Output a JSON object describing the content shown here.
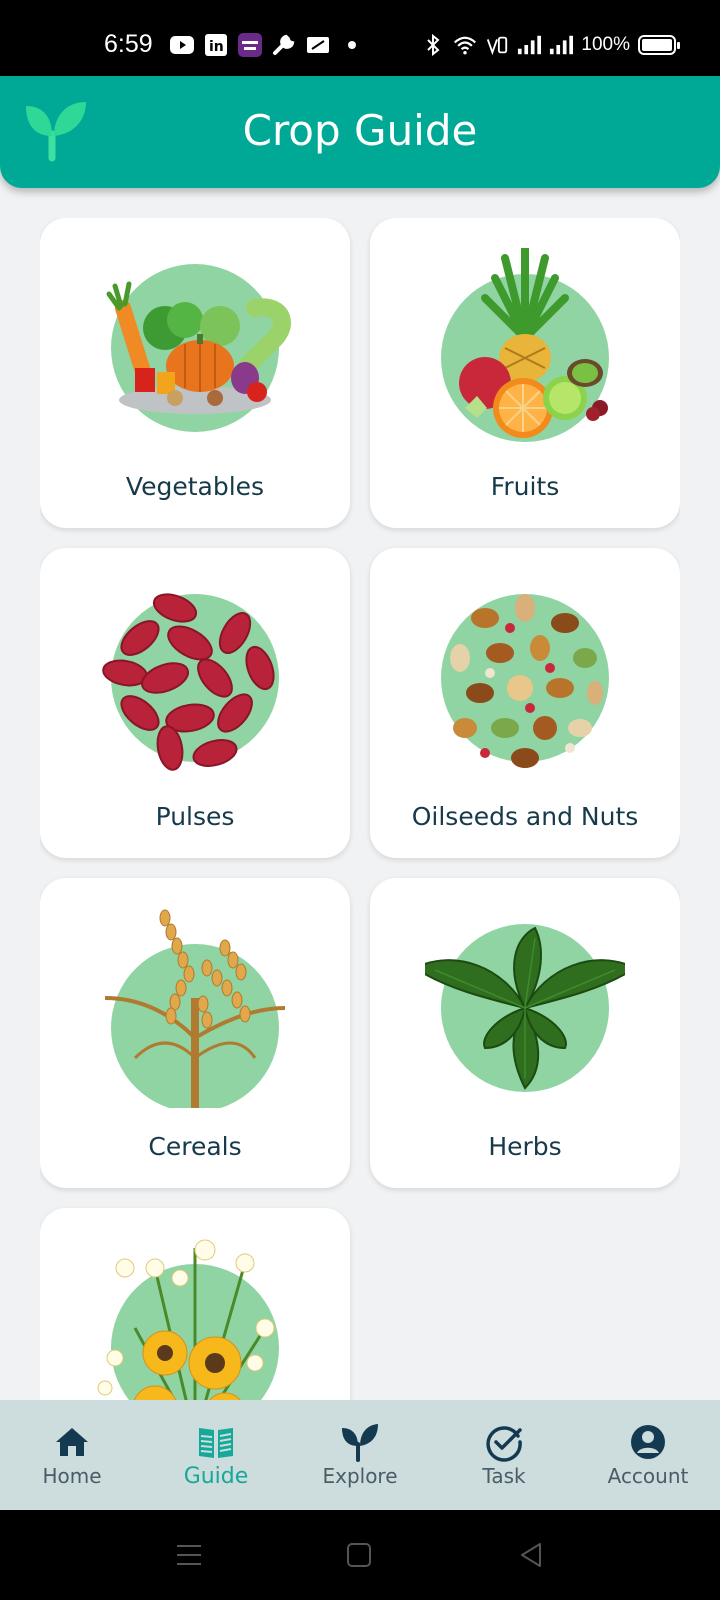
{
  "status_bar": {
    "time": "6:59",
    "battery_text": "100%",
    "icons": [
      "youtube-icon",
      "linkedin-icon",
      "yono-sbi-icon",
      "wrench-icon",
      "card-icon",
      "dot-icon",
      "bluetooth-icon",
      "wifi-icon",
      "volte-icon",
      "signal-icon",
      "signal-icon",
      "battery-icon"
    ]
  },
  "header": {
    "title": "Crop Guide",
    "logo": "sprout-icon",
    "color": "#00a896"
  },
  "categories": [
    {
      "label": "Vegetables",
      "icon": "vegetables-illustration"
    },
    {
      "label": "Fruits",
      "icon": "fruits-illustration"
    },
    {
      "label": "Pulses",
      "icon": "pulses-illustration"
    },
    {
      "label": "Oilseeds and Nuts",
      "icon": "nuts-illustration"
    },
    {
      "label": "Cereals",
      "icon": "cereals-illustration"
    },
    {
      "label": "Herbs",
      "icon": "herbs-illustration"
    },
    {
      "label": "",
      "icon": "flowers-illustration"
    }
  ],
  "bottom_nav": {
    "items": [
      {
        "label": "Home",
        "icon": "home-icon"
      },
      {
        "label": "Guide",
        "icon": "book-icon",
        "active": true
      },
      {
        "label": "Explore",
        "icon": "sprout-icon"
      },
      {
        "label": "Task",
        "icon": "check-circle-icon"
      },
      {
        "label": "Account",
        "icon": "account-icon"
      }
    ],
    "active_color": "#16a99a"
  },
  "system_nav": {
    "icons": [
      "menu-icon",
      "square-icon",
      "back-triangle-icon"
    ]
  }
}
